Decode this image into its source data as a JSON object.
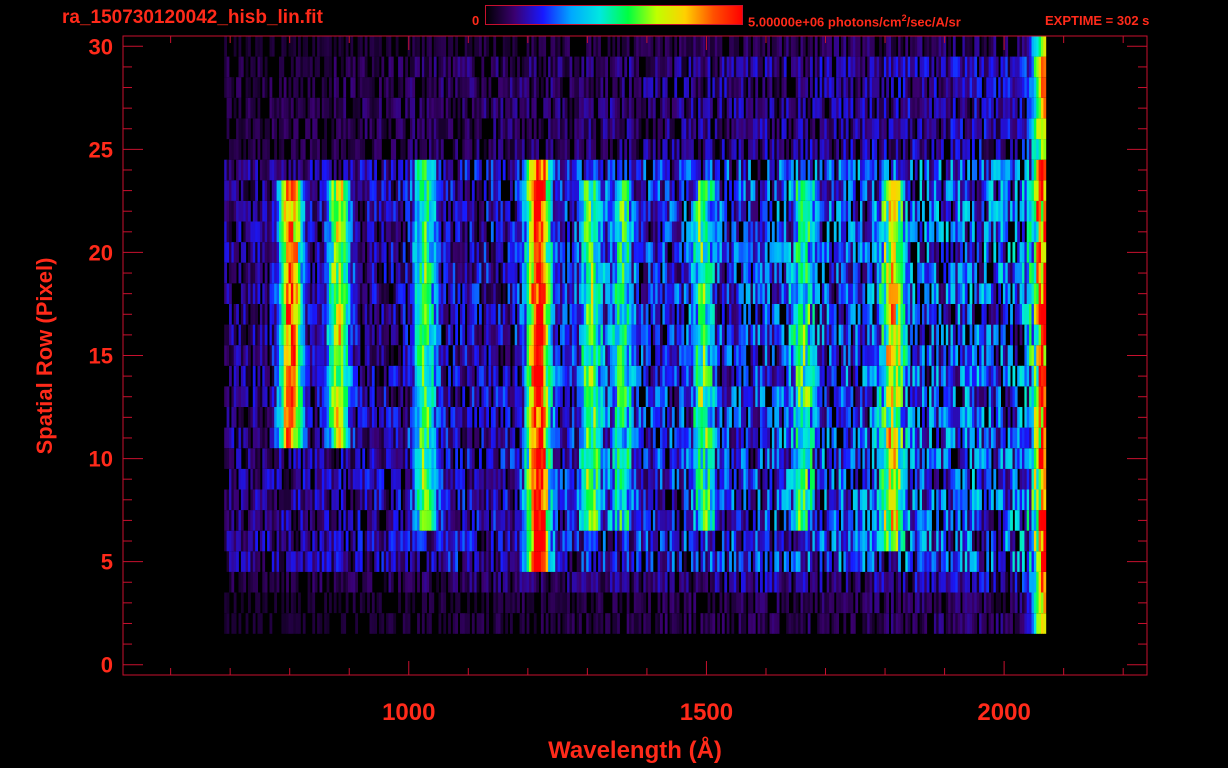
{
  "header": {
    "file_name": "ra_150730120042_hisb_lin.fit",
    "colorbar_min": "0",
    "colorbar_max": "5.00000e+06 photons/cm",
    "colorbar_max_sup": "2",
    "colorbar_max_tail": "/sec/A/sr",
    "exptime": "EXPTIME = 302 s"
  },
  "colors": {
    "axis": "#ff2a1a",
    "frame": "#c8102e",
    "background": "#000000",
    "colormap": [
      "#000000",
      "#3a0070",
      "#1818ff",
      "#00a8ff",
      "#00e8e0",
      "#00ff40",
      "#c0ff00",
      "#ffd000",
      "#ff5000",
      "#ff0000"
    ]
  },
  "chart_data": {
    "type": "heatmap",
    "title": "",
    "xlabel": "Wavelength (Å)",
    "ylabel": "Spatial Row (Pixel)",
    "xlim": [
      520,
      2240
    ],
    "ylim": [
      -0.5,
      30.5
    ],
    "x_ticks": [
      1000,
      1500,
      2000
    ],
    "y_ticks": [
      0,
      5,
      10,
      15,
      20,
      25,
      30
    ],
    "colorscale_range": [
      0,
      5000000
    ],
    "colorscale_unit": "photons/cm^2/sec/A/sr",
    "spectrum_x_range": [
      690,
      2070
    ],
    "strong_rows": [
      5,
      24
    ],
    "features": [
      {
        "wavelength": 800,
        "rows": [
          11,
          23
        ],
        "peak": 0.85
      },
      {
        "wavelength": 880,
        "rows": [
          11,
          23
        ],
        "peak": 0.6
      },
      {
        "wavelength": 1025,
        "rows": [
          7,
          24
        ],
        "peak": 0.45
      },
      {
        "wavelength": 1216,
        "rows": [
          5,
          24
        ],
        "peak": 0.95
      },
      {
        "wavelength": 1304,
        "rows": [
          7,
          23
        ],
        "peak": 0.45
      },
      {
        "wavelength": 1356,
        "rows": [
          7,
          23
        ],
        "peak": 0.35
      },
      {
        "wavelength": 1493,
        "rows": [
          7,
          23
        ],
        "peak": 0.38
      },
      {
        "wavelength": 1660,
        "rows": [
          7,
          23
        ],
        "peak": 0.35
      },
      {
        "wavelength": 1810,
        "rows": [
          6,
          23
        ],
        "peak": 0.55
      },
      {
        "wavelength": 2065,
        "rows": [
          2,
          30
        ],
        "peak": 0.7
      }
    ]
  }
}
